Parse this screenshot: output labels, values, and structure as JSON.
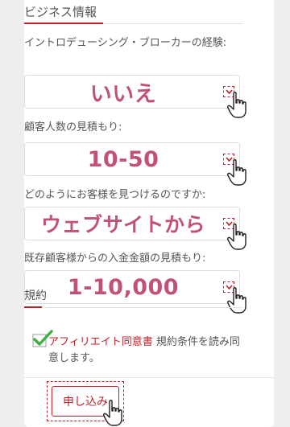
{
  "section": {
    "title": "ビジネス情報"
  },
  "fields": [
    {
      "label": "イントロデューシング・ブローカーの経験:",
      "value": "いいえ"
    },
    {
      "label": "顧客人数の見積もり:",
      "value": "10-50"
    },
    {
      "label": "どのようにお客様を見つけるのですか:",
      "value": "ウェブサイトから"
    },
    {
      "label": "既存顧客様からの入金金額の見積もり:",
      "value": "1-10,000"
    }
  ],
  "terms": {
    "title": "規約",
    "link_text": "アフィリエイト同意書",
    "text_after_link": " 規約条件を読み同意します。",
    "checked": true
  },
  "submit": {
    "label": "申し込み"
  },
  "colors": {
    "accent": "#c0202a",
    "value_text": "#c0527a",
    "check_green": "#3cb043"
  }
}
